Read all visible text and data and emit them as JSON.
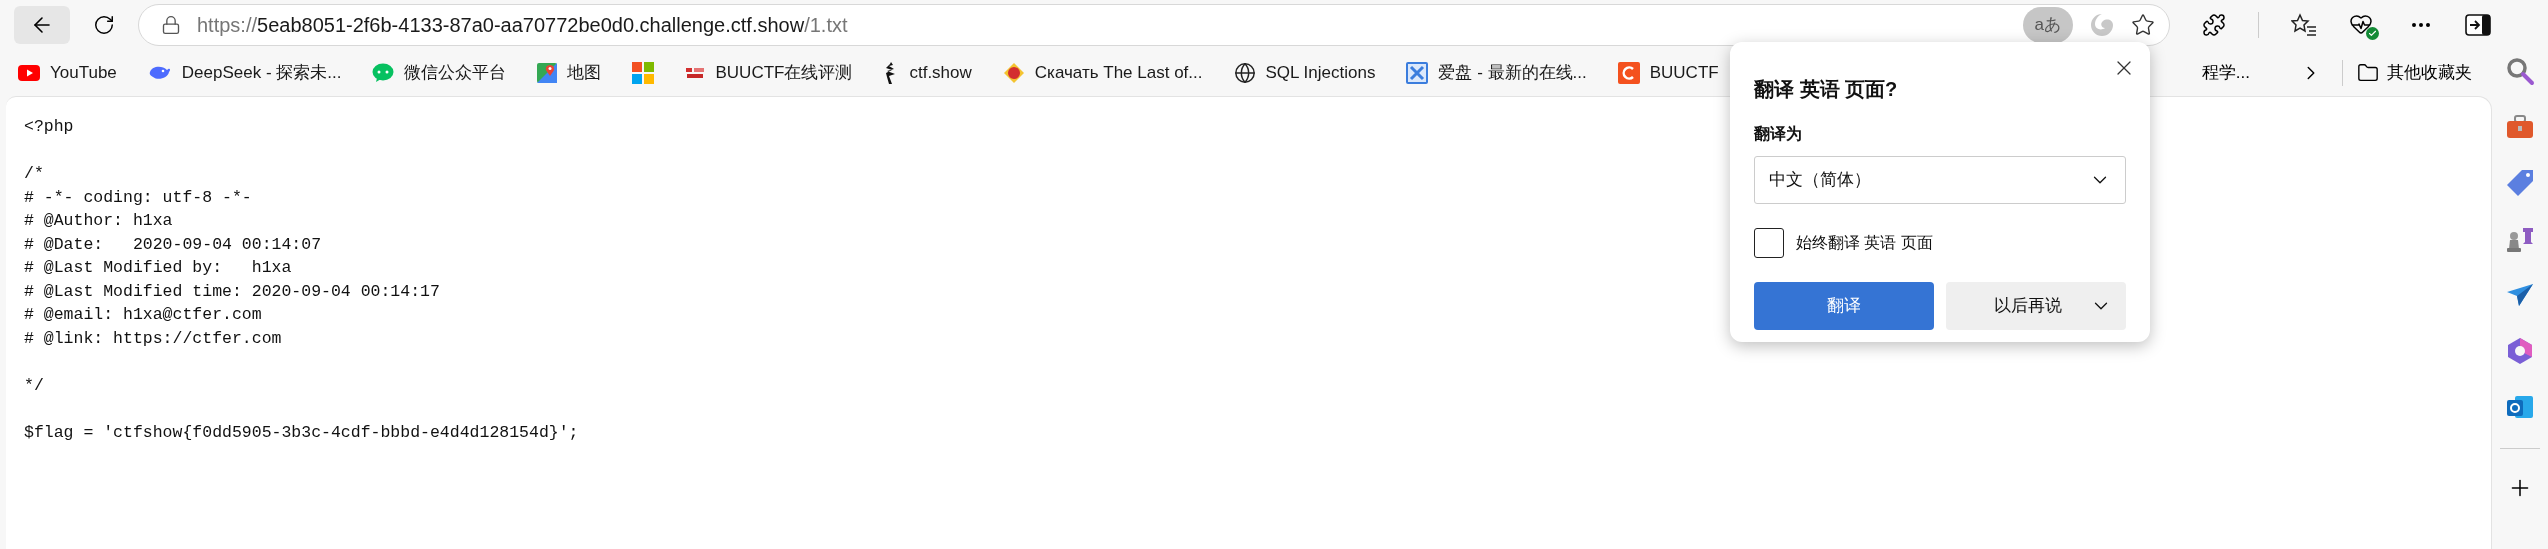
{
  "toolbar": {
    "url_scheme": "https://",
    "url_host": "5eab8051-2f6b-4133-87a0-aa70772be0d0.challenge.ctf.show",
    "url_path": "/1.txt",
    "translate_label": "aあ"
  },
  "bookmarks": [
    {
      "label": "YouTube",
      "kind": "youtube"
    },
    {
      "label": "DeepSeek - 探索未...",
      "kind": "whale"
    },
    {
      "label": "微信公众平台",
      "kind": "chat"
    },
    {
      "label": "地图",
      "kind": "map"
    },
    {
      "kind": "windows"
    },
    {
      "label": "BUUCTF在线评测",
      "kind": "buu"
    },
    {
      "label": "ctf.show",
      "kind": "figure"
    },
    {
      "label": "Скачать The Last of...",
      "kind": "badge"
    },
    {
      "label": "SQL Injections",
      "kind": "globe"
    },
    {
      "label": "爱盘 - 最新的在线...",
      "kind": "cross"
    },
    {
      "label": "BUUCTF",
      "kind": "orange"
    }
  ],
  "bookmark_cut": "程学...",
  "other_bookmarks": "其他收藏夹",
  "document": {
    "blocks": [
      [
        "<?php"
      ],
      [
        "/*",
        "# -*- coding: utf-8 -*-",
        "# @Author: h1xa",
        "# @Date:   2020-09-04 00:14:07",
        "# @Last Modified by:   h1xa",
        "# @Last Modified time: 2020-09-04 00:14:17",
        "# @email: h1xa@ctfer.com",
        "# @link: https://ctfer.com"
      ],
      [
        "*/"
      ],
      [
        "$flag = 'ctfshow{f0dd5905-3b3c-4cdf-bbbd-e4d4d128154d}';"
      ]
    ]
  },
  "translate_popup": {
    "title": "翻译 英语 页面?",
    "target_label": "翻译为",
    "target_value": "中文（简体）",
    "always": {
      "label": "始终翻译 英语 页面",
      "checked": false
    },
    "translate_button": "翻译",
    "later_button": "以后再说"
  }
}
